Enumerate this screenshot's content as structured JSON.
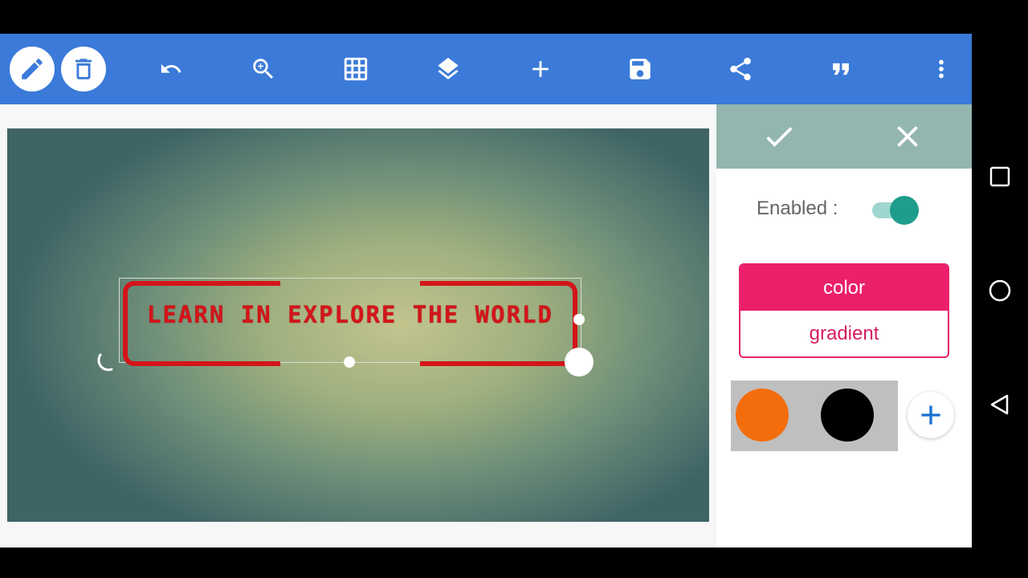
{
  "toolbar": {
    "buttons": [
      {
        "name": "pencil-icon"
      },
      {
        "name": "trash-icon"
      },
      {
        "name": "undo-icon"
      },
      {
        "name": "zoom-in-icon"
      },
      {
        "name": "grid-icon"
      },
      {
        "name": "layers-icon"
      },
      {
        "name": "add-icon"
      },
      {
        "name": "save-icon"
      },
      {
        "name": "share-icon"
      },
      {
        "name": "quote-icon"
      },
      {
        "name": "more-vert-icon"
      }
    ],
    "color": "#3b7ad9"
  },
  "canvas": {
    "text_layer": "LEARN IN EXPLORE THE WORLD",
    "text_color": "#d3151a"
  },
  "panel": {
    "confirm_icon": "check-icon",
    "cancel_icon": "close-icon",
    "enabled_label": "Enabled :",
    "enabled": true,
    "fill_modes": [
      {
        "label": "color",
        "active": true
      },
      {
        "label": "gradient",
        "active": false
      }
    ],
    "swatches": [
      {
        "color": "#f46d0d"
      },
      {
        "color": "#000000"
      }
    ],
    "add_swatch_icon": "plus-icon",
    "accent": "#ec1f6a",
    "switch_color": "#1e9c8c"
  },
  "system_nav": {
    "buttons": [
      {
        "name": "recents-icon"
      },
      {
        "name": "home-icon"
      },
      {
        "name": "back-icon"
      }
    ]
  }
}
